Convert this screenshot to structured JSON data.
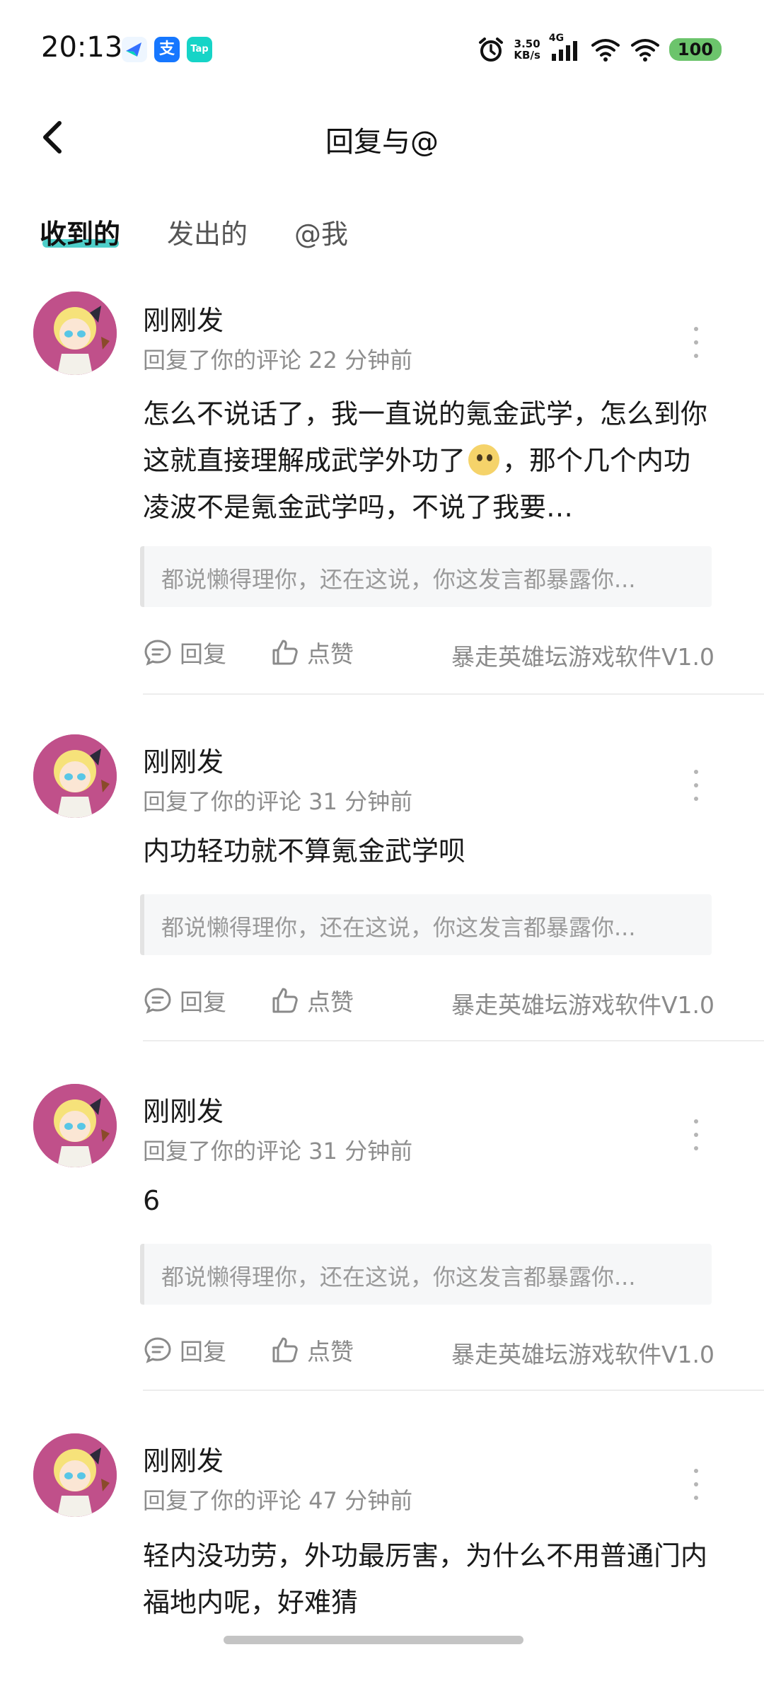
{
  "status_bar": {
    "time": "20:13",
    "speed_value": "3.50",
    "speed_unit": "KB/s",
    "network": "4G",
    "battery": "100",
    "icons": [
      "feishu-icon",
      "alipay-icon",
      "taptap-icon",
      "alarm-icon",
      "signal-icon",
      "wifi-icon"
    ]
  },
  "header": {
    "title": "回复与@"
  },
  "tabs": [
    {
      "label": "收到的",
      "active": true
    },
    {
      "label": "发出的",
      "active": false
    },
    {
      "label": "@我",
      "active": false
    }
  ],
  "comments": [
    {
      "username": "刚刚发",
      "meta": "回复了你的评论 22 分钟前",
      "body_part1": "怎么不说话了，我一直说的氪金武学，怎么到你这就直接理解成武学外功了",
      "body_part2": "，那个几个内功凌波不是氪金武学吗，不说了我要…",
      "quote": "都说懒得理你，还在这说，你这发言都暴露你...",
      "reply_label": "回复",
      "like_label": "点赞",
      "source": "暴走英雄坛游戏软件V1.0"
    },
    {
      "username": "刚刚发",
      "meta": "回复了你的评论 31 分钟前",
      "body_part1": "内功轻功就不算氪金武学呗",
      "quote": "都说懒得理你，还在这说，你这发言都暴露你...",
      "reply_label": "回复",
      "like_label": "点赞",
      "source": "暴走英雄坛游戏软件V1.0"
    },
    {
      "username": "刚刚发",
      "meta": "回复了你的评论 31 分钟前",
      "body_part1": "6",
      "quote": "都说懒得理你，还在这说，你这发言都暴露你...",
      "reply_label": "回复",
      "like_label": "点赞",
      "source": "暴走英雄坛游戏软件V1.0"
    },
    {
      "username": "刚刚发",
      "meta": "回复了你的评论 47 分钟前",
      "body_part1": "轻内没功劳，外功最厉害，为什么不用普通门内福地内呢，好难猜"
    }
  ],
  "colors": {
    "tab_underline": "#2fc5c0",
    "battery": "#6cc46c",
    "avatar_bg": "#c0508a"
  }
}
